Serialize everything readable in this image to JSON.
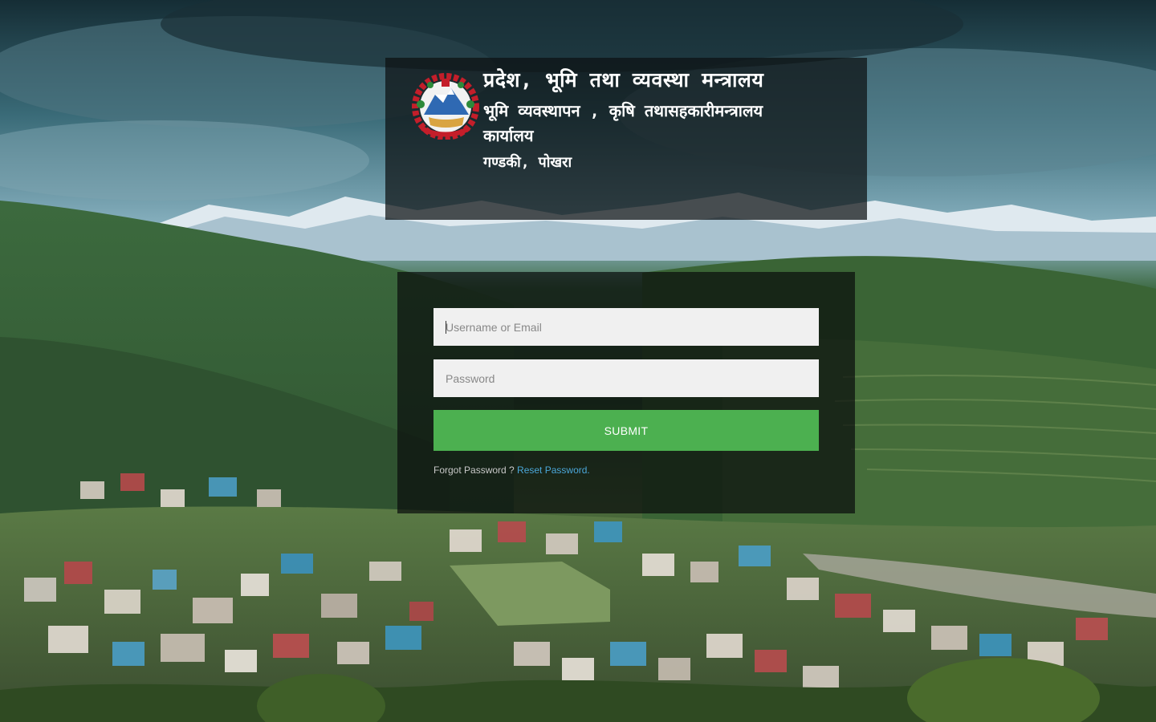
{
  "header": {
    "title": "प्रदेश, भूमि तथा व्यवस्था मन्त्रालय",
    "subtitle": "भूमि व्यवस्थापन , कृषि तथासहकारीमन्त्रालय कार्यालय",
    "location": "गण्डकी, पोखरा"
  },
  "login": {
    "username_placeholder": "Username or Email",
    "password_placeholder": "Password",
    "submit_label": "SUBMIT",
    "forgot_text": "Forgot Password ? ",
    "reset_link": "Reset Password."
  },
  "colors": {
    "submit": "#4cb050",
    "link": "#4aa6d8",
    "panel": "rgba(12,16,18,0.72)"
  },
  "icons": {
    "emblem": "nepal-emblem-icon"
  }
}
